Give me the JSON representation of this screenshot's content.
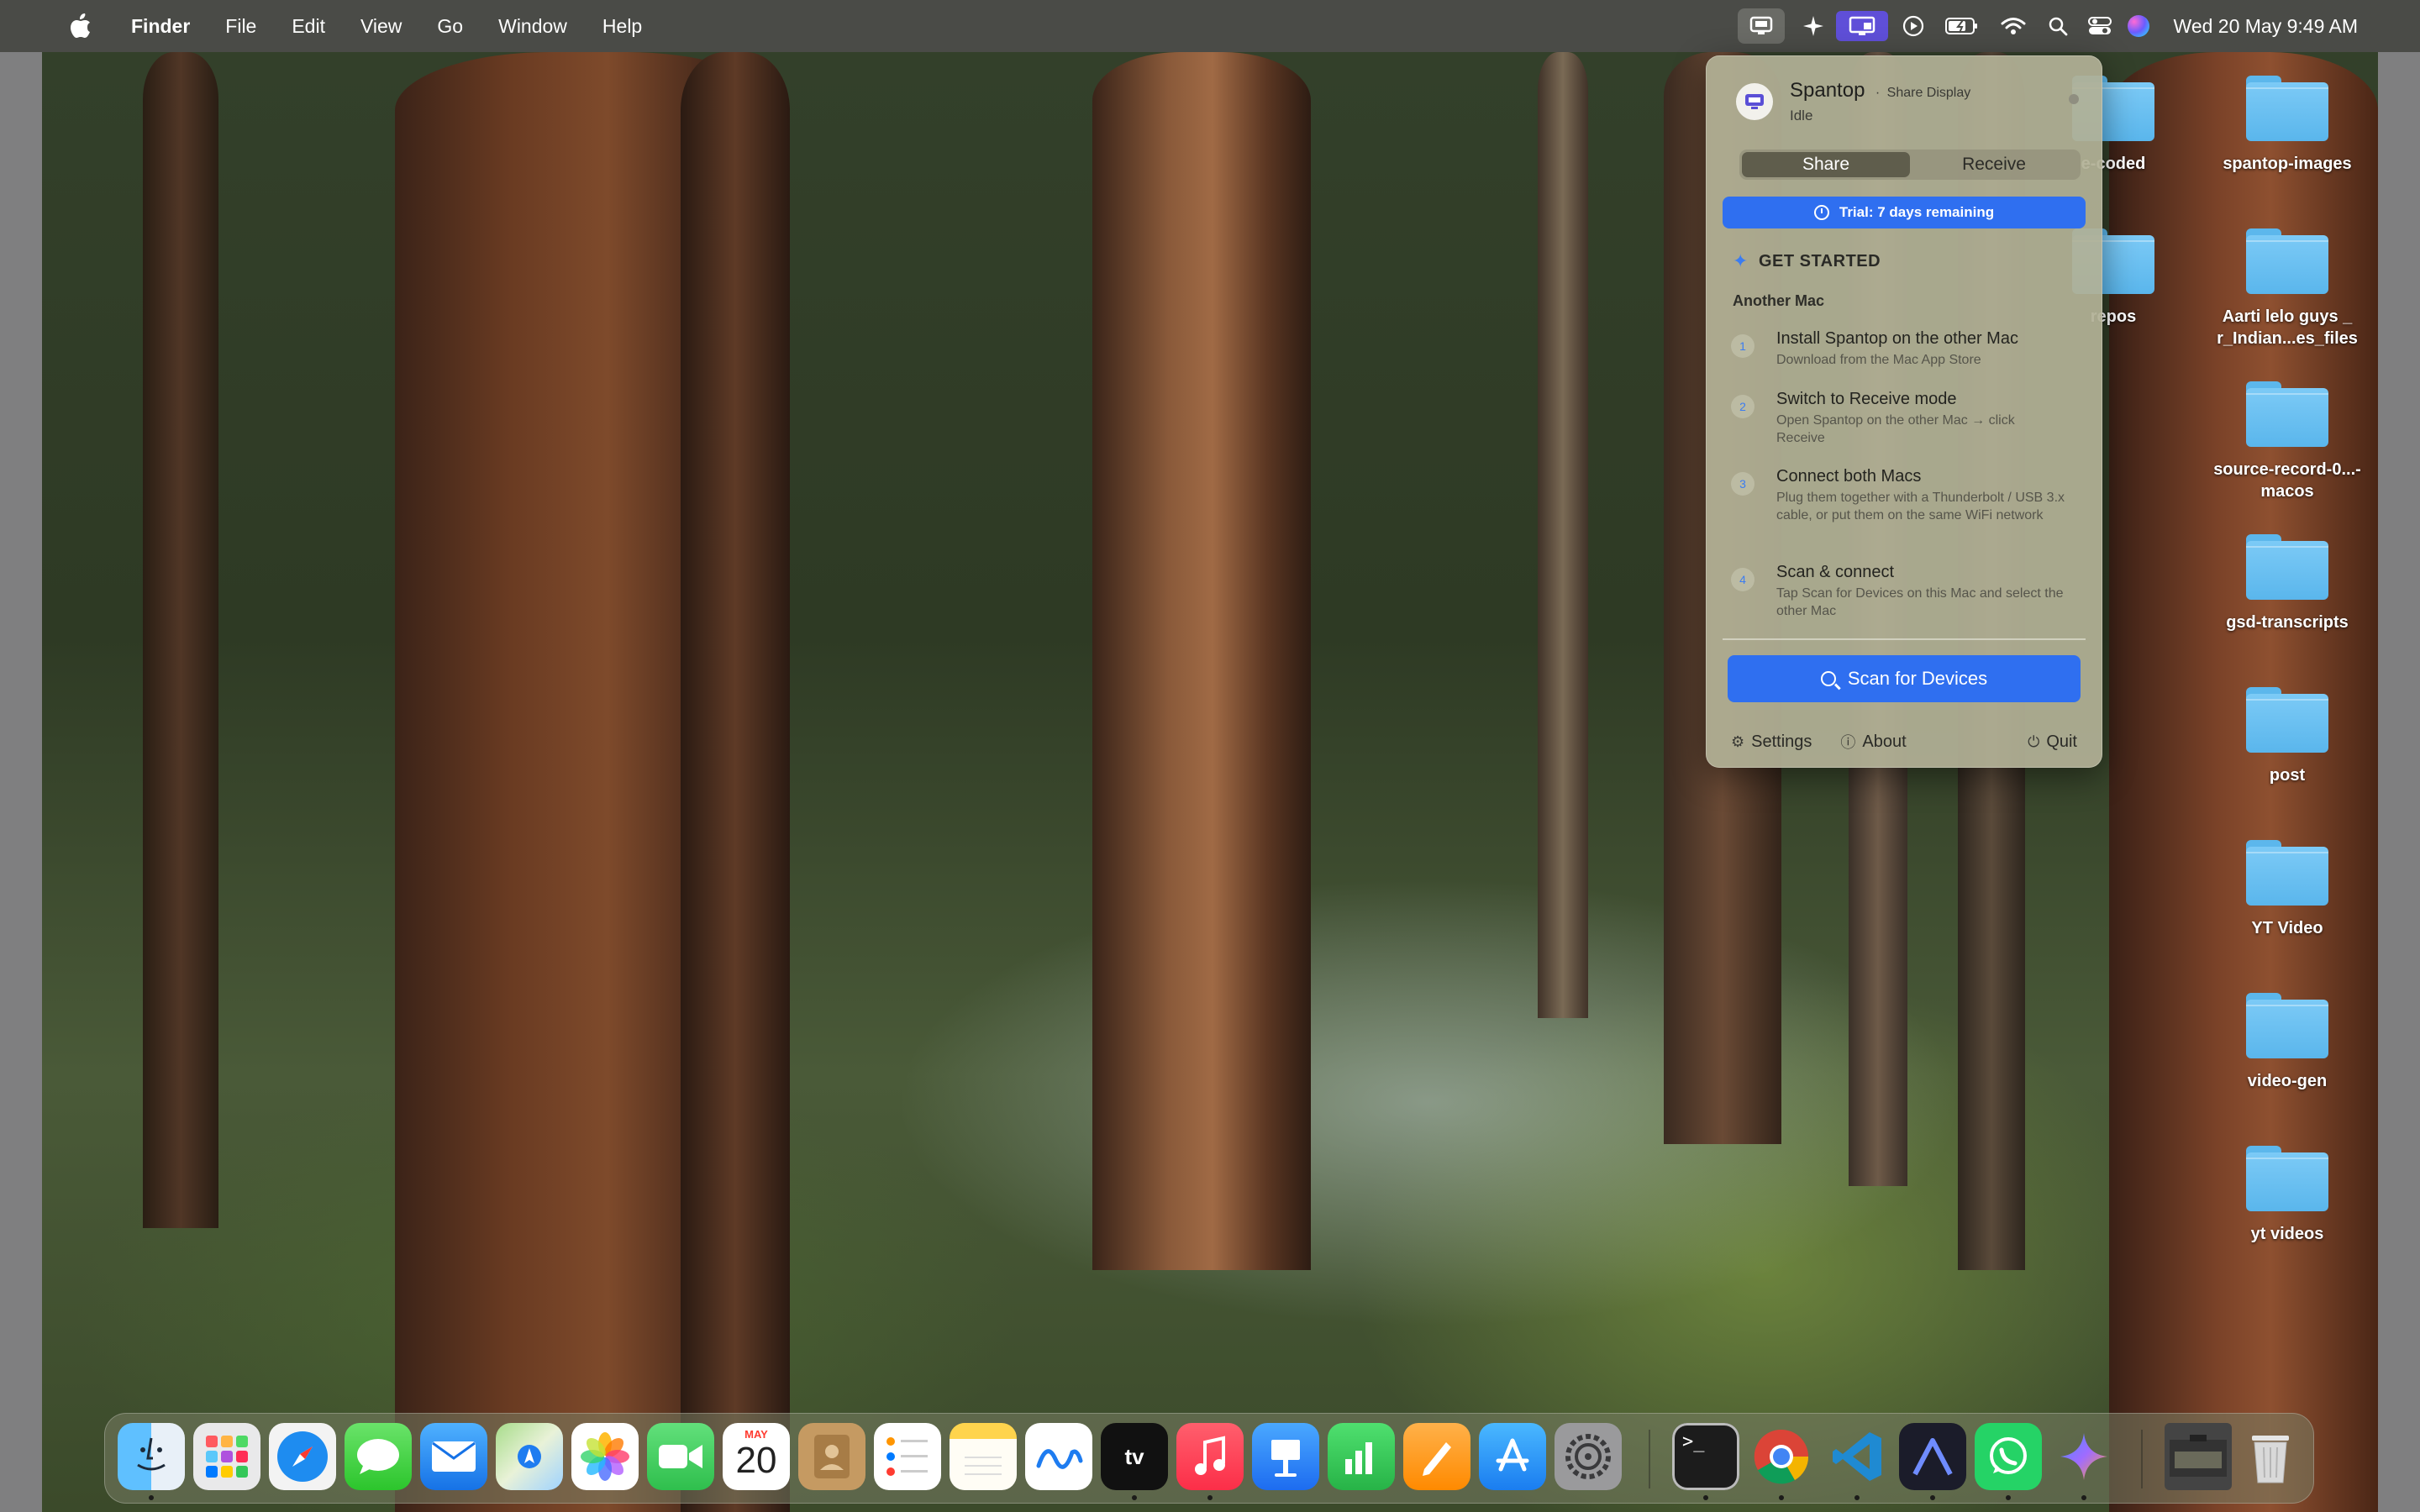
{
  "menubar": {
    "app_name": "Finder",
    "items": [
      "File",
      "Edit",
      "View",
      "Go",
      "Window",
      "Help"
    ],
    "clock": "Wed 20 May  9:49 AM",
    "status_icons": [
      "spantop-icon",
      "sparkle-icon",
      "screen-share-icon",
      "play-icon",
      "battery-icon",
      "wifi-icon",
      "search-icon",
      "control-center-icon",
      "siri-icon"
    ]
  },
  "desktop_icons": [
    {
      "label": "e-coded"
    },
    {
      "label": "spantop-images"
    },
    {
      "label": "repos"
    },
    {
      "label": "Aarti lelo guys _ r_Indian...es_files"
    },
    {
      "label": "source-record-0...-macos"
    },
    {
      "label": "gsd-transcripts"
    },
    {
      "label": "post"
    },
    {
      "label": "YT Video"
    },
    {
      "label": "video-gen"
    },
    {
      "label": "yt videos"
    }
  ],
  "panel": {
    "app_name": "Spantop",
    "separator": "·",
    "subtitle": "Share Display",
    "state": "Idle",
    "tabs": [
      "Share",
      "Receive"
    ],
    "active_tab": "Share",
    "trial": "Trial: 7 days remaining",
    "get_started": "GET STARTED",
    "section": "Another Mac",
    "steps": [
      {
        "num": "1",
        "title": "Install Spantop on the other Mac",
        "desc": "Download from the Mac App Store"
      },
      {
        "num": "2",
        "title": "Switch to Receive mode",
        "desc": "Open Spantop on the other Mac → click Receive"
      },
      {
        "num": "3",
        "title": "Connect both Macs",
        "desc": "Plug them together with a Thunderbolt / USB 3.x cable, or put them on the same WiFi network"
      },
      {
        "num": "4",
        "title": "Scan & connect",
        "desc": "Tap Scan for Devices on this Mac and select the other Mac"
      }
    ],
    "scan_button": "Scan for Devices",
    "footer": {
      "settings": "Settings",
      "about": "About",
      "quit": "Quit"
    },
    "colors": {
      "accent": "#2f6ff0",
      "panel_bg": "#b2b096"
    }
  },
  "dock": {
    "apps": [
      "Finder",
      "Launchpad",
      "Safari",
      "Messages",
      "Mail",
      "Maps",
      "Photos",
      "FaceTime",
      "Calendar",
      "Contacts",
      "Reminders",
      "Notes",
      "Freeform",
      "TV",
      "Music",
      "Keynote",
      "Numbers",
      "Pages",
      "App Store",
      "System Settings",
      "Terminal",
      "Chrome",
      "VS Code",
      "Linear",
      "WhatsApp",
      "Gemini",
      "Screenshot",
      "Trash"
    ],
    "calendar_month": "MAY",
    "calendar_day": "20"
  }
}
